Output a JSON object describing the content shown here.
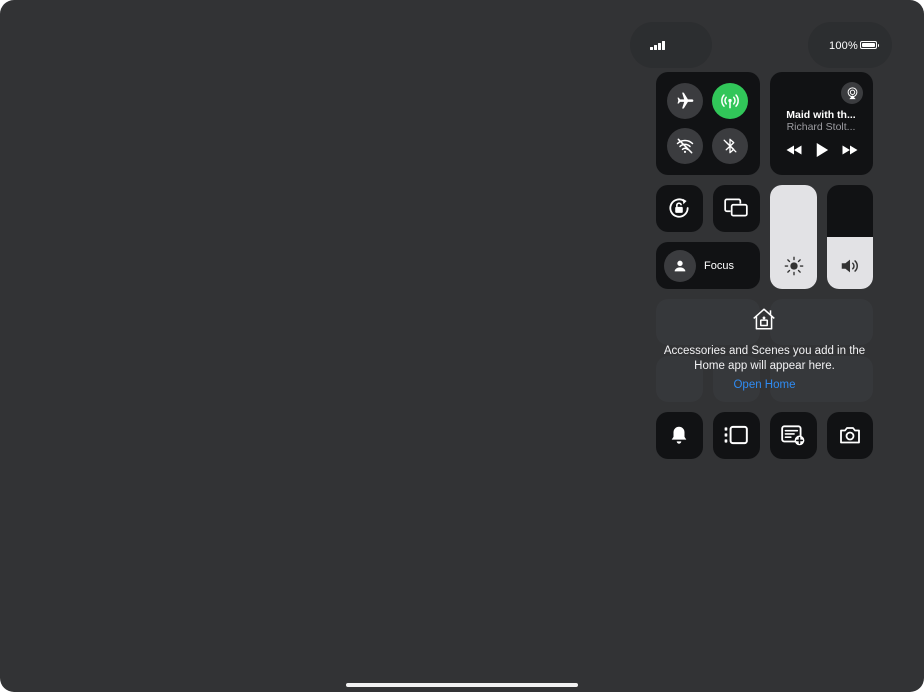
{
  "status_bar": {
    "battery_percent": "100%",
    "signal_bars": 4
  },
  "connectivity": {
    "airplane_mode": false,
    "cellular_data": true,
    "wifi": false,
    "bluetooth": false,
    "cellular_color": "#31c659"
  },
  "now_playing": {
    "title": "Maid with th...",
    "artist": "Richard Stolt..."
  },
  "sliders": {
    "brightness_level": 1.0,
    "volume_level": 0.5
  },
  "focus": {
    "label": "Focus"
  },
  "home": {
    "message": "Accessories and Scenes you add in the Home app will appear here.",
    "link": "Open Home",
    "link_color": "#2f8bf2"
  },
  "icons": {
    "airplane": "airplane-icon",
    "cellular": "antenna-icon",
    "wifi": "wifi-off-icon",
    "bluetooth": "bluetooth-off-icon",
    "airplay": "airplay-audio-icon",
    "rewind": "rewind-icon",
    "play": "play-icon",
    "forward": "fast-forward-icon",
    "orientation": "orientation-lock-icon",
    "mirroring": "screen-mirroring-icon",
    "brightness": "sun-icon",
    "volume": "speaker-icon",
    "focus": "person-icon",
    "home": "home-icon",
    "alarm": "bell-icon",
    "stage_manager": "stage-manager-icon",
    "quick_note": "quick-note-icon",
    "camera": "camera-icon"
  }
}
